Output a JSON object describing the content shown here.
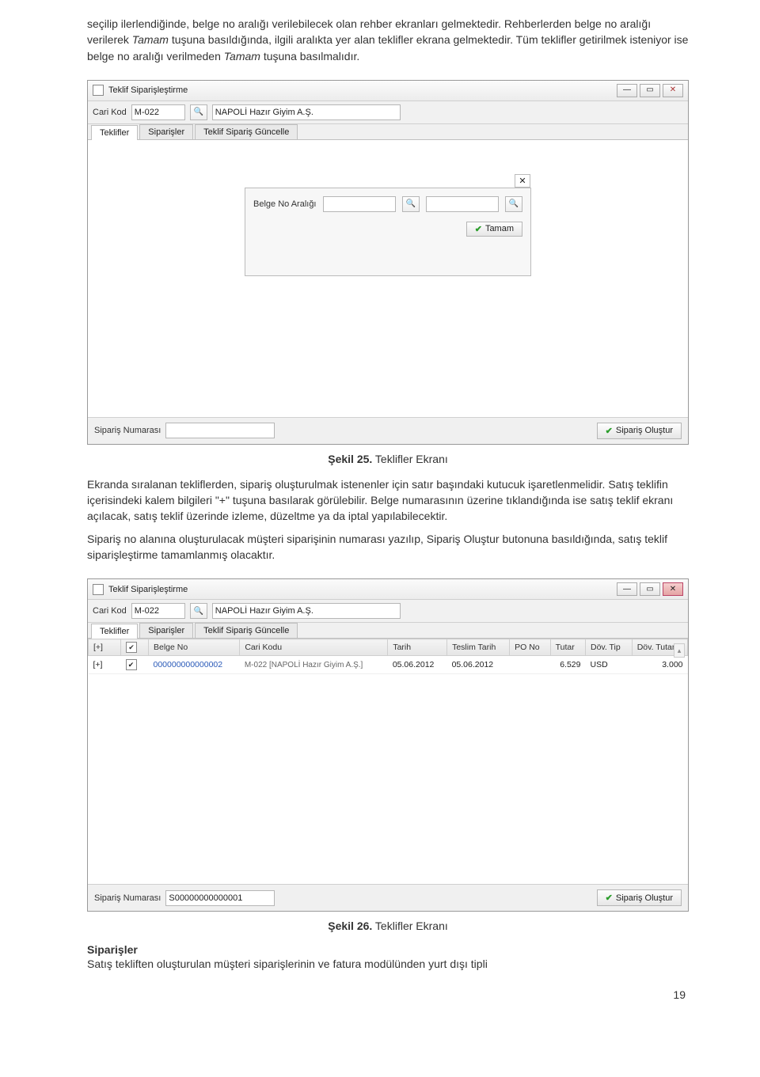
{
  "paragraphs": {
    "p1a": "seçilip ilerlendiğinde, belge no aralığı verilebilecek olan rehber ekranları gelmektedir. Rehberlerden belge no aralığı verilerek ",
    "p1_tamam": "Tamam",
    "p1b": " tuşuna basıldığında, ilgili aralıkta yer alan teklifler ekrana gelmektedir. Tüm teklifler getirilmek isteniyor ise belge no aralığı verilmeden ",
    "p1c": " tuşuna basılmalıdır.",
    "p2": "Ekranda sıralanan tekliflerden, sipariş oluşturulmak istenenler için satır başındaki kutucuk işaretlenmelidir. Satış teklifin içerisindeki kalem bilgileri \"+\" tuşuna basılarak görülebilir. Belge numarasının üzerine tıklandığında ise satış teklif ekranı açılacak, satış teklif üzerinde izleme, düzeltme ya da iptal yapılabilecektir.",
    "p3": "Sipariş no alanına oluşturulacak müşteri siparişinin numarası yazılıp, Sipariş Oluştur butonuna basıldığında, satış teklif siparişleştirme tamamlanmış olacaktır.",
    "sec_title": "Siparişler",
    "p4": "Satış tekliften oluşturulan müşteri siparişlerinin ve fatura modülünden yurt dışı tipli"
  },
  "caption25_bold": "Şekil 25.",
  "caption25_rest": " Teklifler Ekranı",
  "caption26_bold": "Şekil 26.",
  "caption26_rest": " Teklifler Ekranı",
  "pageno": "19",
  "win1": {
    "title": "Teklif Siparişleştirme",
    "cari_label": "Cari Kod",
    "cari_value": "M-022",
    "cari_desc": "NAPOLİ Hazır Giyim A.Ş.",
    "tabs": [
      "Teklifler",
      "Siparişler",
      "Teklif Sipariş Güncelle"
    ],
    "dlg_label": "Belge No Aralığı",
    "dlg_btn": "Tamam",
    "sip_label": "Sipariş Numarası",
    "sip_btn": "Sipariş Oluştur"
  },
  "win2": {
    "title": "Teklif Siparişleştirme",
    "cari_label": "Cari Kod",
    "cari_value": "M-022",
    "cari_desc": "NAPOLİ Hazır Giyim A.Ş.",
    "tabs": [
      "Teklifler",
      "Siparişler",
      "Teklif Sipariş Güncelle"
    ],
    "sip_label": "Sipariş Numarası",
    "sip_value": "S00000000000001",
    "sip_btn": "Sipariş Oluştur",
    "headers": [
      "[+]",
      "",
      "Belge No",
      "Cari Kodu",
      "Tarih",
      "Teslim Tarih",
      "PO No",
      "Tutar",
      "Döv. Tip",
      "Döv. Tutar"
    ],
    "row": {
      "belge": "000000000000002",
      "cari": "M-022 [NAPOLİ Hazır Giyim A.Ş.]",
      "tarih": "05.06.2012",
      "teslim": "05.06.2012",
      "pono": "",
      "tutar": "6.529",
      "dovtip": "USD",
      "dovtutar": "3.000"
    }
  }
}
